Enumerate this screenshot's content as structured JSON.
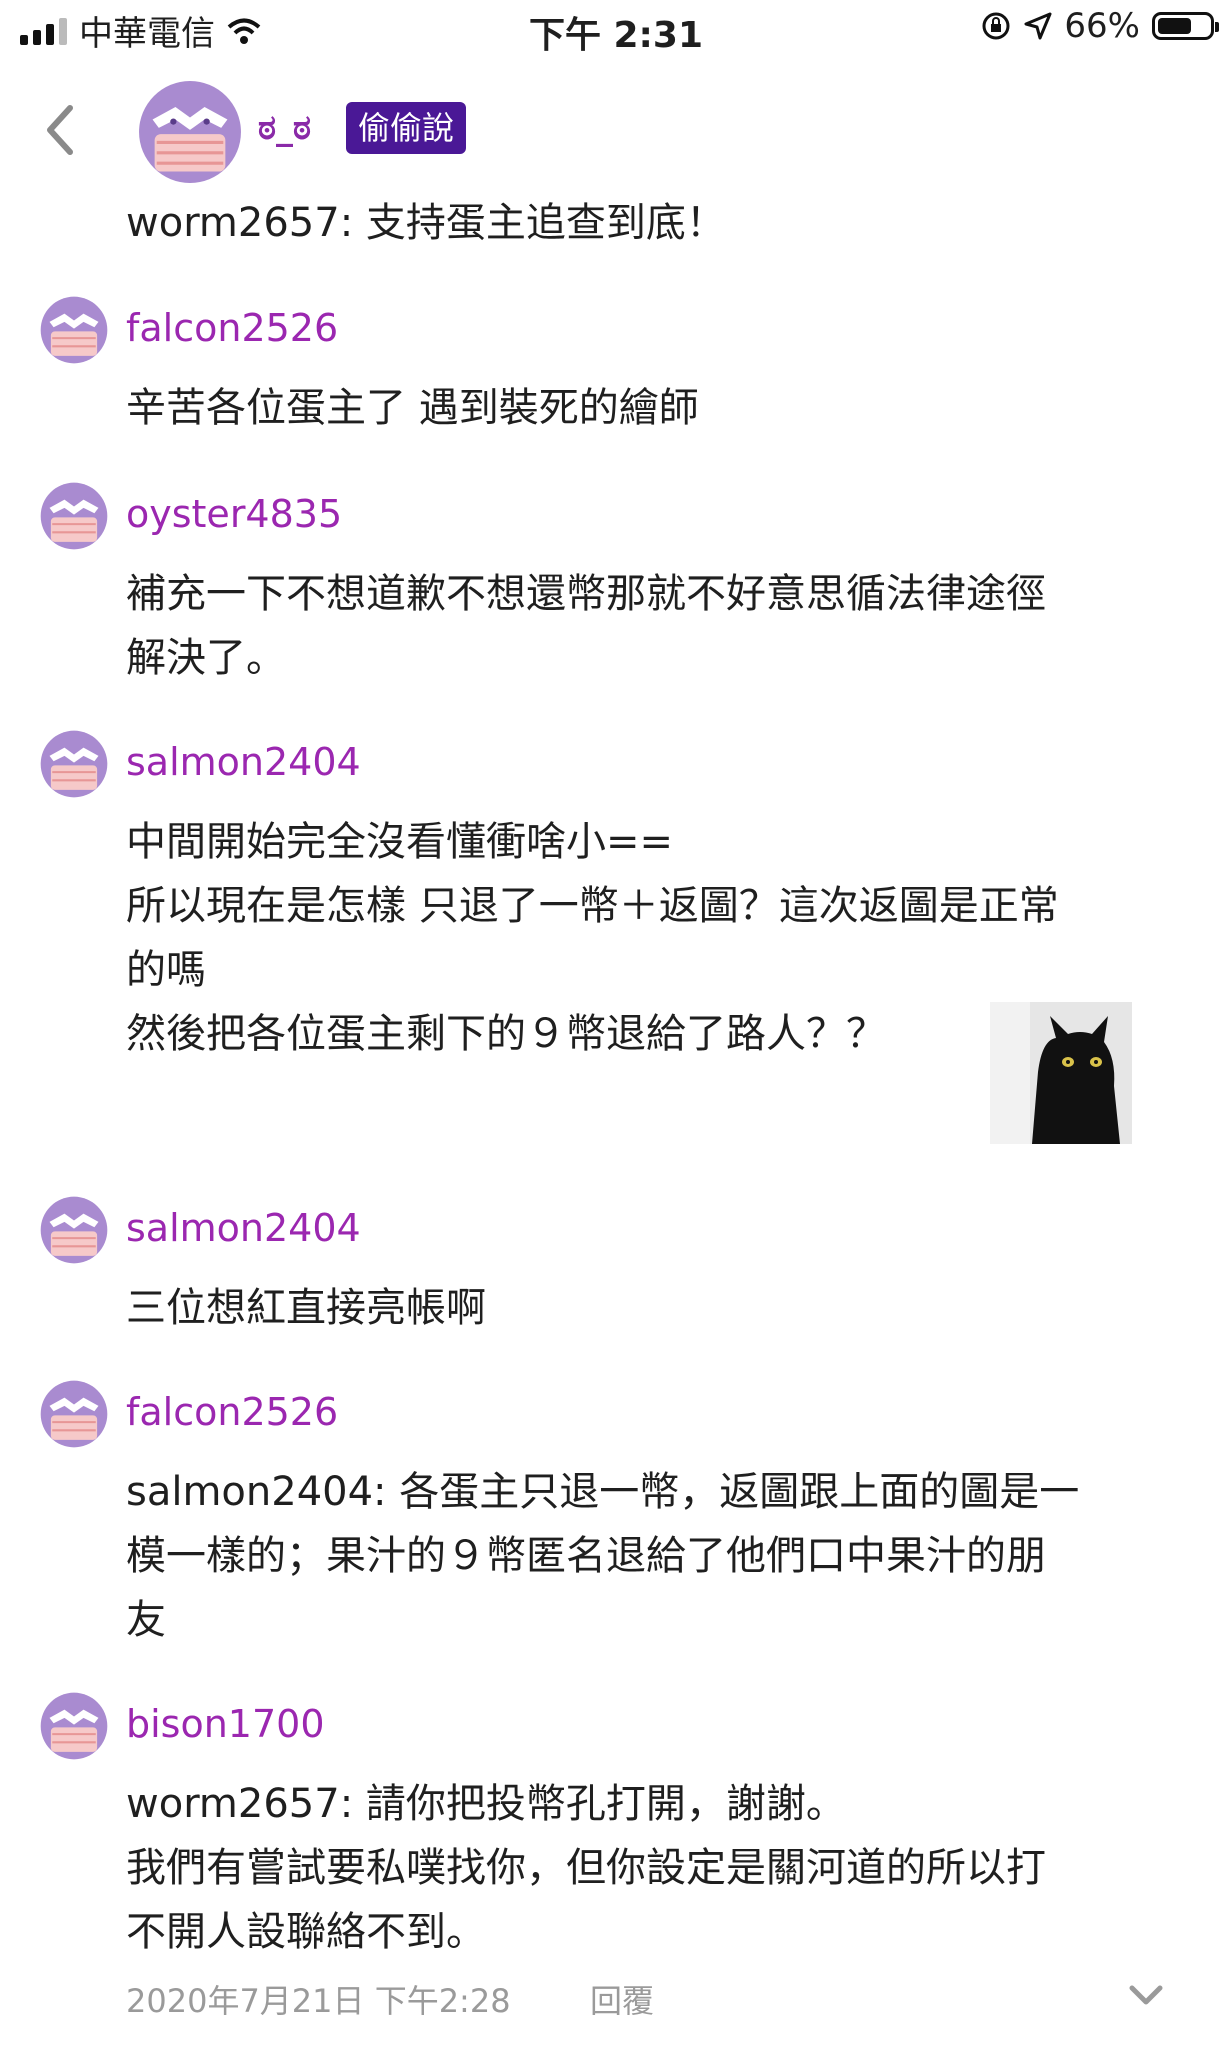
{
  "status_bar": {
    "carrier": "中華電信",
    "time": "下午 2:31",
    "battery_percent": "66%",
    "battery_level": 0.66
  },
  "header": {
    "name": "ಠ_ಠ",
    "badge": "偷偷說"
  },
  "first_comment_text": "worm2657: 支持蛋主追查到底！",
  "comments": [
    {
      "user": "falcon2526",
      "lines": [
        "辛苦各位蛋主了 遇到裝死的繪師"
      ]
    },
    {
      "user": "oyster4835",
      "lines": [
        "補充一下不想道歉不想還幣那就不好意思循法律途徑",
        "解決了。"
      ]
    },
    {
      "user": "salmon2404",
      "lines": [
        "中間開始完全沒看懂衝啥小==",
        "所以現在是怎樣 只退了一幣＋返圖？這次返圖是正常",
        "的嗎",
        "然後把各位蛋主剩下的９幣退給了路人？？"
      ]
    },
    {
      "user": "salmon2404",
      "lines": [
        "三位想紅直接亮帳啊"
      ]
    },
    {
      "user": "falcon2526",
      "lines": [
        "salmon2404: 各蛋主只退一幣，返圖跟上面的圖是一",
        "模一樣的；果汁的９幣匿名退給了他們口中果汁的朋",
        "友"
      ]
    },
    {
      "user": "bison1700",
      "lines": [
        "worm2657: 請你把投幣孔打開，謝謝。",
        "我們有嘗試要私噗找你，但你設定是關河道的所以打",
        "不開人設聯絡不到。"
      ]
    }
  ],
  "footer": {
    "timestamp": "2020年7月21日 下午2:28",
    "reply_label": "回覆"
  },
  "colors": {
    "username": "#9b27b0",
    "badge_bg": "#4a1896",
    "avatar_purple": "#a98bd0",
    "avatar_pink": "#f2b6b6"
  },
  "icons": [
    "back-chevron-icon",
    "signal-icon",
    "wifi-icon",
    "lock-rotation-icon",
    "location-arrow-icon",
    "battery-icon",
    "chevron-down-icon"
  ]
}
